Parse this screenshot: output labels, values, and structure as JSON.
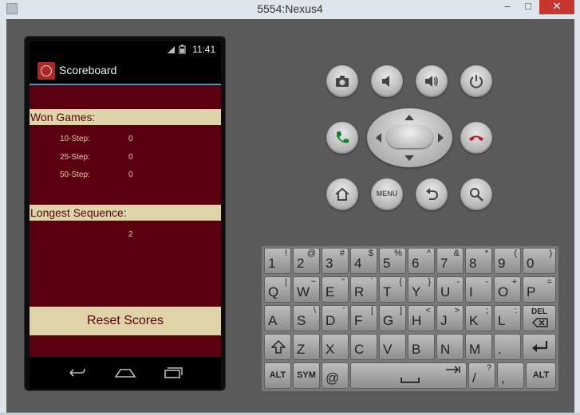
{
  "window": {
    "title": "5554:Nexus4",
    "minimize": "–",
    "maximize": "□",
    "close": "✕"
  },
  "statusbar": {
    "icons": "📶 🔋",
    "time": "11:41"
  },
  "app": {
    "title": "Scoreboard"
  },
  "won_games": {
    "header": "Won Games:",
    "rows": [
      {
        "label": "10-Step:",
        "value": "0"
      },
      {
        "label": "25-Step:",
        "value": "0"
      },
      {
        "label": "50-Step:",
        "value": "0"
      }
    ]
  },
  "longest": {
    "header": "Longest Sequence:",
    "value": "2"
  },
  "reset_label": "Reset Scores",
  "controls": {
    "menu_label": "MENU"
  },
  "keyboard": {
    "row1": [
      [
        "1",
        "!"
      ],
      [
        "2",
        "@"
      ],
      [
        "3",
        "#"
      ],
      [
        "4",
        "$"
      ],
      [
        "5",
        "%"
      ],
      [
        "6",
        "^"
      ],
      [
        "7",
        "&"
      ],
      [
        "8",
        "*"
      ],
      [
        "9",
        "("
      ],
      [
        "0",
        ")"
      ]
    ],
    "row2": [
      [
        "Q",
        "|"
      ],
      [
        "W",
        "~"
      ],
      [
        "E",
        "\""
      ],
      [
        "R",
        "`"
      ],
      [
        "T",
        "{"
      ],
      [
        "Y",
        "}"
      ],
      [
        "U",
        "-"
      ],
      [
        "I",
        "-"
      ],
      [
        "O",
        "+"
      ],
      [
        "P",
        "="
      ]
    ],
    "row3": [
      [
        "A",
        ""
      ],
      [
        "S",
        "\\"
      ],
      [
        "D",
        "'"
      ],
      [
        "F",
        "["
      ],
      [
        "G",
        "]"
      ],
      [
        "H",
        "<"
      ],
      [
        "J",
        ">"
      ],
      [
        "K",
        ";"
      ],
      [
        "L",
        ":"
      ]
    ],
    "row4": [
      [
        "Z",
        ""
      ],
      [
        "X",
        ""
      ],
      [
        "C",
        ""
      ],
      [
        "V",
        ""
      ],
      [
        "B",
        ""
      ],
      [
        "N",
        ""
      ],
      [
        "M",
        ""
      ],
      [
        ".",
        ""
      ]
    ],
    "del": "DEL",
    "alt": "ALT",
    "sym": "SYM",
    "at": "@",
    "slash": "/",
    "question": "?",
    "comma": ","
  }
}
